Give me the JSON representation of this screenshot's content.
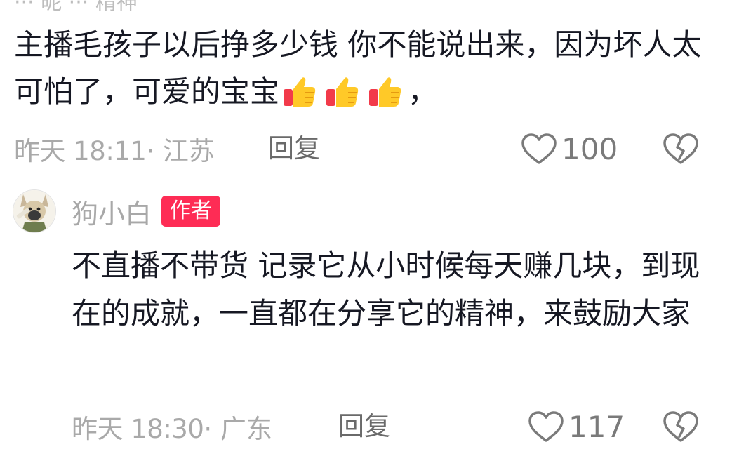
{
  "top_partial_text": "··· 昵 ··· 精神",
  "comment1": {
    "text_before_emoji": "主播毛孩子以后挣多少钱 你不能说出来，因为坏人太可怕了，可爱的宝宝",
    "emoji": [
      "thumbs-up",
      "thumbs-up",
      "thumbs-up"
    ],
    "text_after_emoji": "，",
    "time": "昨天 18:11",
    "location": "· 江苏",
    "reply_label": "回复",
    "like_count": "100"
  },
  "comment2": {
    "username": "狗小白",
    "badge": "作者",
    "text": "不直播不带货 记录它从小时候每天赚几块，到现在的成就，一直都在分享它的精神，来鼓励大家",
    "time": "昨天 18:30",
    "location": "· 广东",
    "reply_label": "回复",
    "like_count": "117"
  },
  "colors": {
    "text": "#161823",
    "meta": "#a9a9a9",
    "badge_bg": "#fe2c55",
    "icon": "#7a7a7a"
  }
}
